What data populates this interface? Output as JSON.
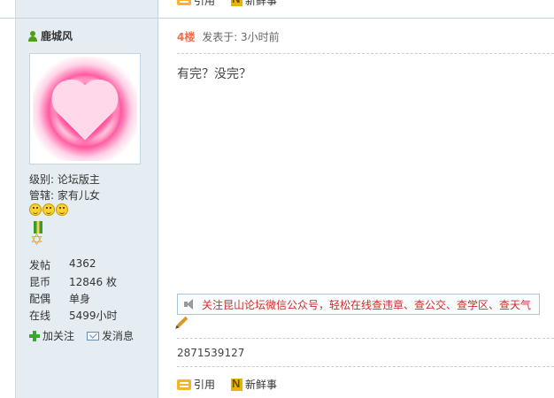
{
  "prev_post": {
    "quote_label": "引用",
    "fresh_label": "新鲜事"
  },
  "author": {
    "name": "鹿城风",
    "level": "级别: 论坛版主",
    "moderates": "管辖: 家有儿女",
    "stats": [
      {
        "key": "发帖",
        "value": "4362"
      },
      {
        "key": "昆币",
        "value": "12846 枚"
      },
      {
        "key": "配偶",
        "value": "单身"
      },
      {
        "key": "在线",
        "value": "5499小时"
      }
    ],
    "follow_label": "加关注",
    "message_label": "发消息"
  },
  "post": {
    "floor": "4楼",
    "posted": "发表于: 3小时前",
    "content": "有完？没完？",
    "notice": "关注昆山论坛微信公众号，轻松在线查违章、查公交、查学区、查天气",
    "signature": "2871539127",
    "quote_label": "引用",
    "fresh_label": "新鲜事"
  }
}
